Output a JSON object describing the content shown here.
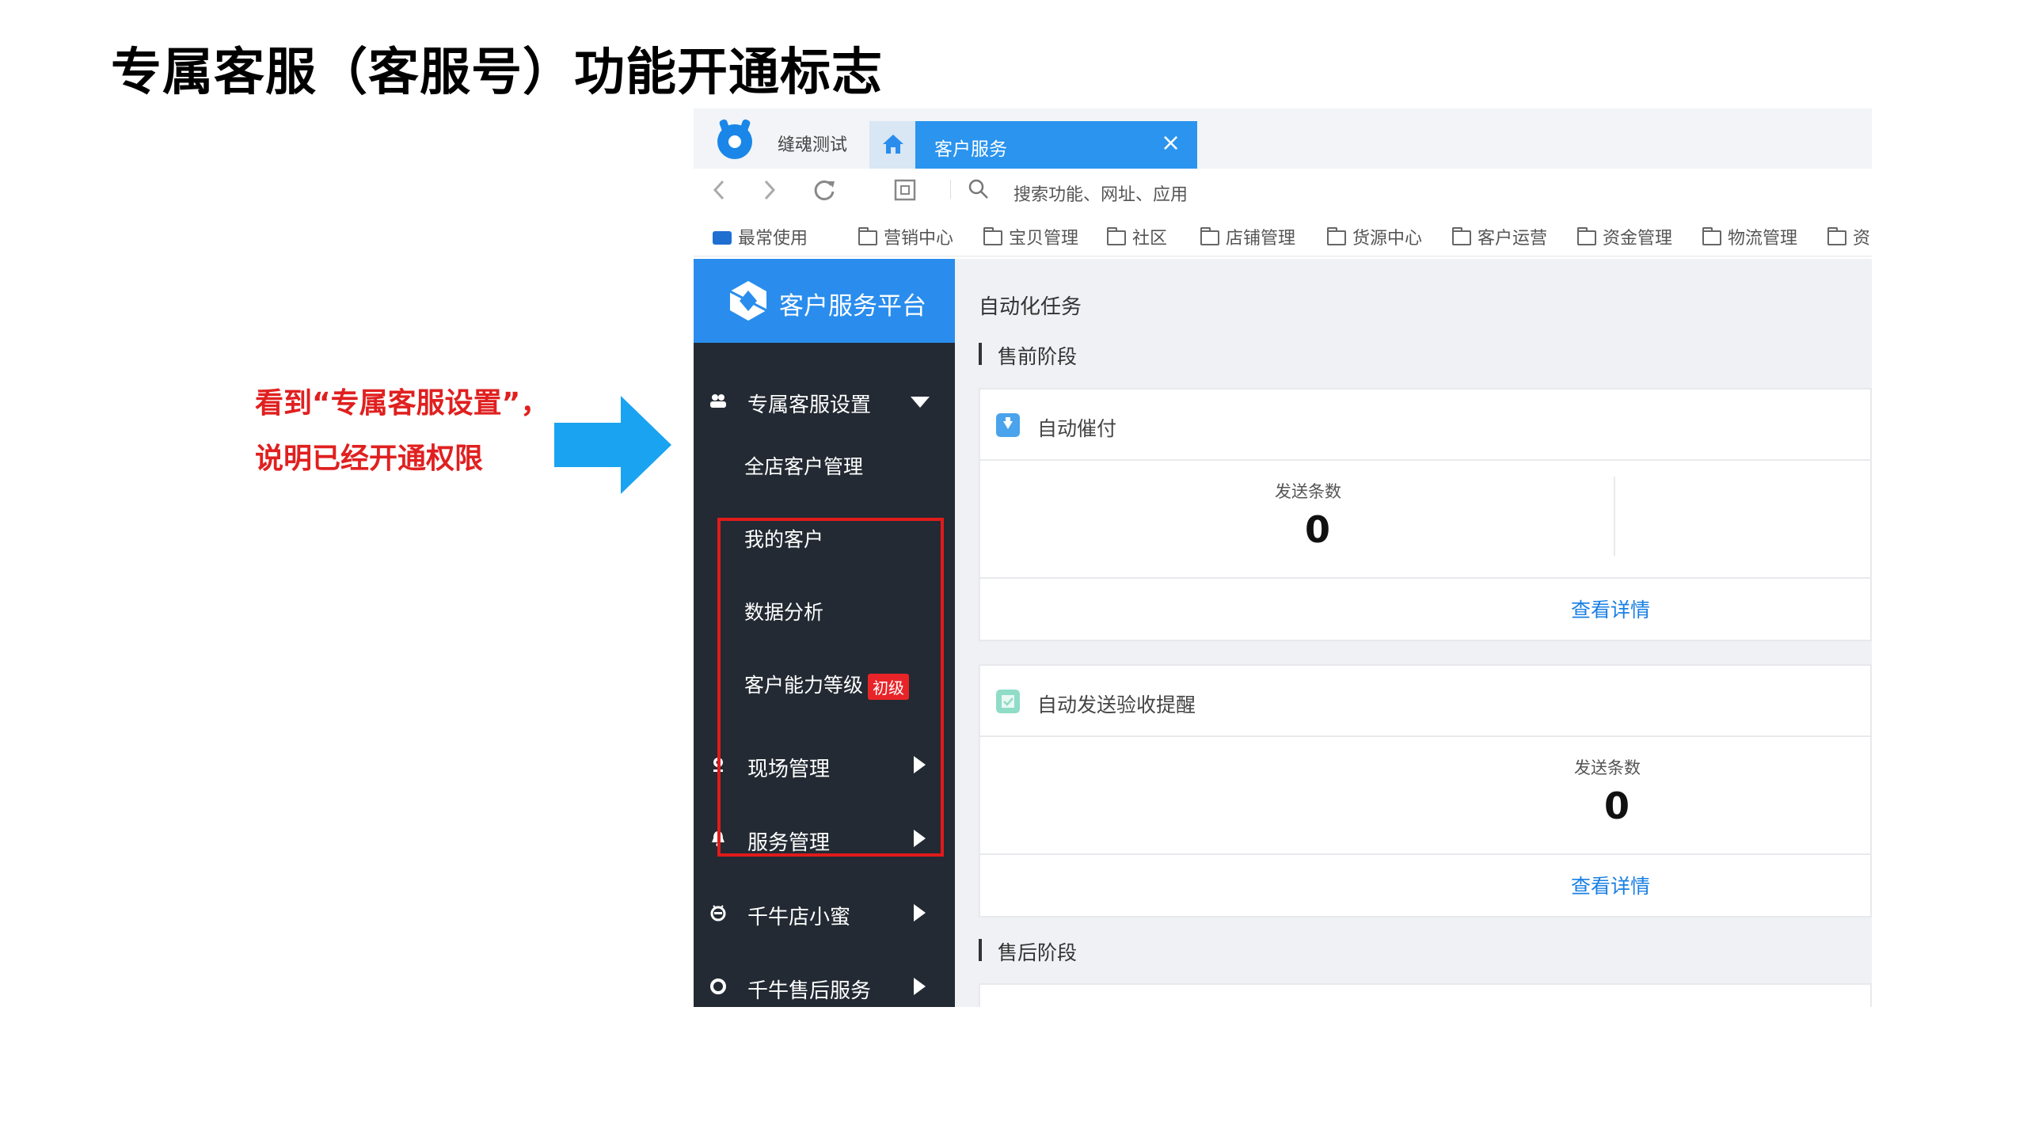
{
  "slide": {
    "title": "专属客服（客服号）功能开通标志",
    "annotation_line1": "看到“专属客服设置”，",
    "annotation_line2": "说明已经开通权限"
  },
  "browser": {
    "store_name": "缝魂测试",
    "active_tab": "客户服务",
    "close_glyph": "×",
    "search_placeholder": "搜索功能、网址、应用",
    "bookmarks": [
      "最常使用",
      "营销中心",
      "宝贝管理",
      "社区",
      "店铺管理",
      "货源中心",
      "客户运营",
      "资金管理",
      "物流管理",
      "资"
    ]
  },
  "sidebar": {
    "platform_title": "客户服务平台",
    "group_open": "专属客服设置",
    "sub_items": [
      "全店客户管理",
      "我的客户",
      "数据分析",
      "客户能力等级"
    ],
    "level_badge": "初级",
    "groups": [
      "现场管理",
      "服务管理",
      "千牛店小蜜",
      "千牛售后服务"
    ]
  },
  "main": {
    "title": "自动化任务",
    "stage_pre": "售前阶段",
    "stage_post": "售后阶段",
    "card1": {
      "title": "自动催付",
      "stat_label": "发送条数",
      "stat_value": "0",
      "link": "查看详情"
    },
    "card2": {
      "title": "自动发送验收提醒",
      "stat_label": "发送条数",
      "stat_value": "0",
      "link": "查看详情"
    }
  },
  "colors": {
    "accent": "#2a94ee",
    "sidebar_bg": "#232a33",
    "highlight_red": "#e01b1b",
    "arrow_blue": "#1aa3f0"
  }
}
